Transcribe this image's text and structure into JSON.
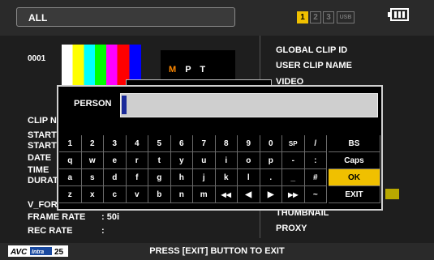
{
  "topbar": {
    "tab_label": "ALL",
    "slots": [
      "1",
      "2",
      "3"
    ],
    "usb_label": "USB",
    "active_slot_color": "#f0c000",
    "battery_icon": "battery-icon"
  },
  "thumbnail": {
    "clip_number": "0001",
    "second_thumb_text": {
      "m": "M",
      "pt": "P T"
    }
  },
  "left_info": {
    "clip_name_partial": "CLIP N",
    "start1_partial": "START",
    "start2_partial": "START",
    "date_partial": "DATE",
    "time_partial": "TIME",
    "duration_partial": "DURAT",
    "video_format_partial": "V_FOR",
    "frame_rate_label": "FRAME RATE",
    "frame_rate_value": ": 50i",
    "rec_rate_label": "REC RATE",
    "rec_rate_value": ":"
  },
  "right_info": {
    "global_clip_id": "GLOBAL CLIP ID",
    "user_clip_name": "USER CLIP NAME",
    "video_partial": "VIDEO",
    "thumbnail": "THUMBNAIL",
    "proxy": "PROXY"
  },
  "dialog": {
    "field_label": "PERSON",
    "field_value": "",
    "keyboard_rows": [
      [
        "1",
        "2",
        "3",
        "4",
        "5",
        "6",
        "7",
        "8",
        "9",
        "0",
        "SP",
        "/"
      ],
      [
        "q",
        "w",
        "e",
        "r",
        "t",
        "y",
        "u",
        "i",
        "o",
        "p",
        "-",
        ":"
      ],
      [
        "a",
        "s",
        "d",
        "f",
        "g",
        "h",
        "j",
        "k",
        "l",
        ".",
        "_",
        "#"
      ],
      [
        "z",
        "x",
        "c",
        "v",
        "b",
        "n",
        "m",
        "◀◀",
        "◀",
        "▶",
        "▶▶",
        "~"
      ]
    ],
    "side_keys": [
      "BS",
      "Caps",
      "OK",
      "EXIT"
    ],
    "selected_key": "OK",
    "cursor_color": "#1a2a9a"
  },
  "bottombar": {
    "message": "PRESS [EXIT] BUTTON TO EXIT",
    "logo": {
      "avc": "AVC",
      "intra": "Intra",
      "num": "25"
    }
  }
}
